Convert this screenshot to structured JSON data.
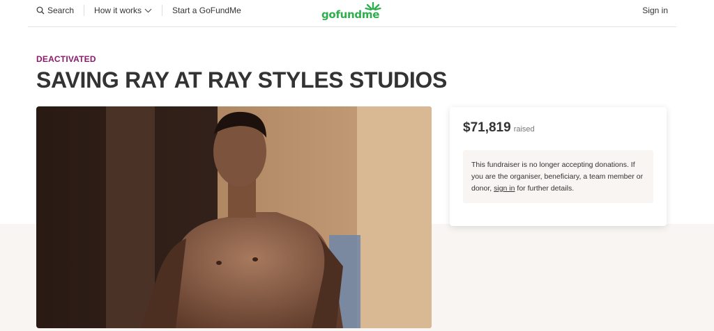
{
  "header": {
    "search_label": "Search",
    "how_it_works_label": "How it works",
    "start_label": "Start a GoFundMe",
    "logo_text": "gofundme",
    "signin_label": "Sign in",
    "brand_color": "#2eae4d",
    "icons": [
      "search-icon",
      "chevron-down-icon"
    ]
  },
  "campaign": {
    "status": "DEACTIVATED",
    "status_color": "#8a1a6b",
    "title": "SAVING RAY AT RAY STYLES STUDIOS"
  },
  "donation_card": {
    "amount": "$71,819",
    "raised_label": "raised",
    "notice_before": "This fundraiser is no longer accepting donations. If you are the organiser, beneficiary, a team member or donor, ",
    "notice_link": "sign in",
    "notice_after": " for further details."
  }
}
